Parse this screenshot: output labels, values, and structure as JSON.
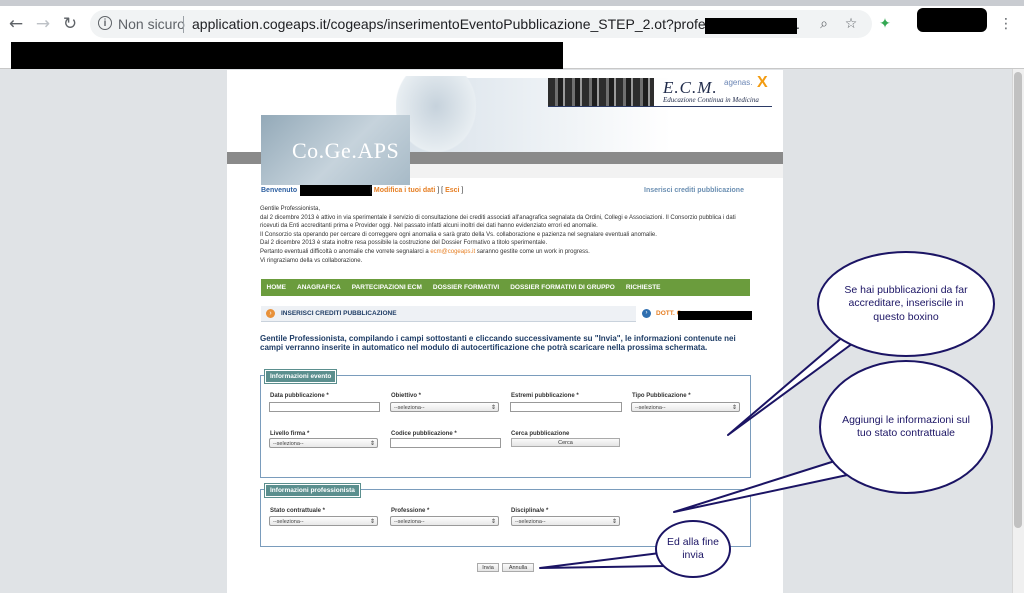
{
  "browser": {
    "security_label": "Non sicuro",
    "url": "application.cogeaps.it/cogeaps/inserimentoEventoPubblicazione_STEP_2.ot?professionista=C",
    "url_suffix": "."
  },
  "header": {
    "logo_text": "Co.Ge.APS",
    "ecm_title": "E.C.M.",
    "ecm_subtitle": "Educazione Continua in Medicina",
    "agenas": "agenas."
  },
  "welcome": {
    "label": "Benvenuto",
    "modify_link": "Modifica i tuoi dati",
    "exit_link": "Esci",
    "page_title": "Inserisci crediti pubblicazione"
  },
  "intro": {
    "lines": [
      "Gentile Professionista,",
      "dal 2 dicembre 2013 è attivo in via sperimentale il servizio di consultazione dei crediti associati all'anagrafica segnalata da Ordini, Collegi e Associazioni. Il Consorzio pubblica i dati ricevuti da Enti accreditanti prima e Provider oggi. Nel passato infatti alcuni inoltri dei dati hanno evidenziato errori ed anomalie.",
      "Il Consorzio sta operando per cercare di correggere ogni anomalia e sarà grato della Vs. collaborazione e pazienza nel segnalare eventuali anomalie.",
      "Dal 2 dicembre 2013 è stata inoltre resa possibile la costruzione del Dossier Formativo a titolo sperimentale.",
      "Pertanto eventuali difficoltà o anomalie che vorrete segnalarci a",
      "saranno gestite come un work in progress.",
      "Vi ringraziamo della vs collaborazione."
    ],
    "email": "ecm@cogeaps.it"
  },
  "nav": [
    "HOME",
    "ANAGRAFICA",
    "PARTECIPAZIONI ECM",
    "DOSSIER FORMATIVI",
    "DOSSIER FORMATIVI DI GRUPPO",
    "RICHIESTE"
  ],
  "subheader": {
    "title": "INSERISCI CREDITI PUBBLICAZIONE",
    "dott": "DOTT. C"
  },
  "instructions": "Gentile Professionista, compilando i campi sottostanti e cliccando successivamente su \"Invia\", le informazioni contenute nei campi verranno inserite in automatico nel modulo di autocertificazione che potrà scaricare nella prossima schermata.",
  "evento": {
    "legend": "Informazioni evento",
    "data_pubblicazione": "Data pubblicazione *",
    "obiettivo": "Obiettivo *",
    "estremi": "Estremi pubblicazione *",
    "tipo": "Tipo Pubblicazione *",
    "livello": "Livello firma *",
    "codice": "Codice pubblicazione *",
    "cerca_label": "Cerca pubblicazione",
    "cerca_button": "Cerca",
    "select_placeholder": "--seleziona--"
  },
  "professionista": {
    "legend": "Informazioni professionista",
    "stato": "Stato contrattuale *",
    "professione": "Professione *",
    "disciplina": "Disciplina/e *"
  },
  "buttons": {
    "invia": "Invia",
    "annulla": "Annulla"
  },
  "callouts": {
    "publications": "Se hai pubblicazioni da far accreditare, inseriscile in questo boxino",
    "contract": "Aggiungi le informazioni sul tuo stato contrattuale",
    "send": "Ed alla fine invia"
  }
}
